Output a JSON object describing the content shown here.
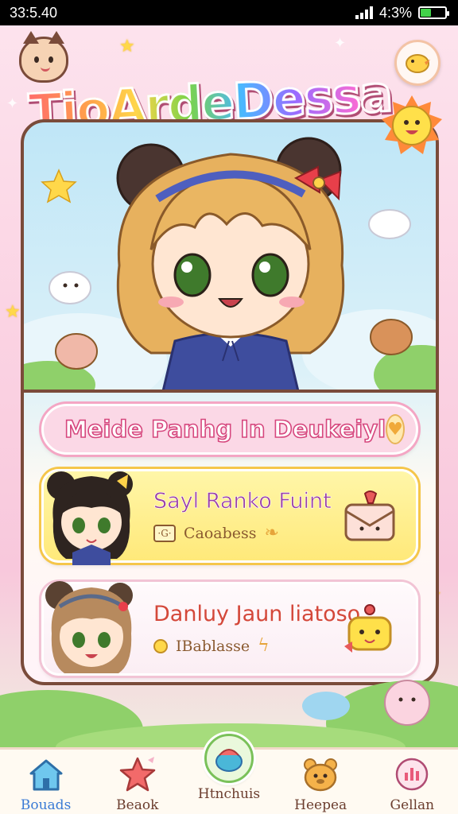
{
  "status_bar": {
    "time": "33:5.40",
    "battery": "4:3%",
    "battery_level": 0.43
  },
  "app": {
    "title": "TioArdeDessa"
  },
  "banner": {
    "text": "Meide Panhg In Deukeiyl",
    "icon": "heart-icon"
  },
  "cards": [
    {
      "title": "Sayl Ranko Fuint",
      "meta_chip": "·G·",
      "meta": "Caoabess",
      "action_icon": "envelope-mascot-icon"
    },
    {
      "title": "Danluy Jaun liatoso",
      "meta": "IBablasse",
      "action_icon": "rocket-mascot-icon"
    }
  ],
  "nav": [
    {
      "label": "Bouads",
      "icon": "house-icon"
    },
    {
      "label": "Beaok",
      "icon": "star-icon"
    },
    {
      "label": "Htnchuis",
      "icon": "center-mascot-icon"
    },
    {
      "label": "Heepea",
      "icon": "bear-icon"
    },
    {
      "label": "Gellan",
      "icon": "gallery-icon"
    }
  ],
  "colors": {
    "frame": "#7a4b3a",
    "banner_text": "#d6477e",
    "card_yellow": "#ffe97a",
    "card_pink": "#fbeef4",
    "nav_active": "#3a7bd5"
  }
}
